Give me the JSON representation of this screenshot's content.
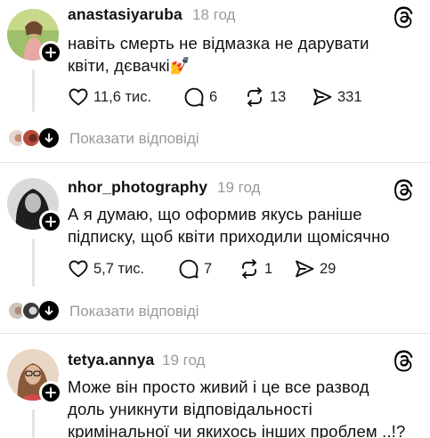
{
  "posts": [
    {
      "username": "anastasiyaruba",
      "time": "18 год",
      "text_lines": [
        "навіть смерть не відмазка не дарувати",
        "квіти, дєвачкі💅"
      ],
      "likes": "11,6 тис.",
      "comments": "6",
      "reposts": "13",
      "shares": "331",
      "show_replies": "Показати відповіді"
    },
    {
      "username": "nhor_photography",
      "time": "19 год",
      "text_lines": [
        "А я думаю, що оформив якусь раніше",
        "підписку, щоб квіти приходили щомісячно"
      ],
      "likes": "5,7 тис.",
      "comments": "7",
      "reposts": "1",
      "shares": "29",
      "show_replies": "Показати відповіді"
    },
    {
      "username": "tetya.annya",
      "time": "19 год",
      "text_lines": [
        "Може він просто живий і це все развод",
        "доль уникнути відповідальності",
        "кримінальної чи якихось інших проблем ..!?"
      ]
    }
  ],
  "icons": {
    "threads": "threads-logo-icon",
    "add": "plus-icon",
    "like": "heart-icon",
    "comment": "comment-bubble-icon",
    "repost": "repost-icon",
    "share": "send-icon",
    "expand": "arrow-down-icon"
  }
}
